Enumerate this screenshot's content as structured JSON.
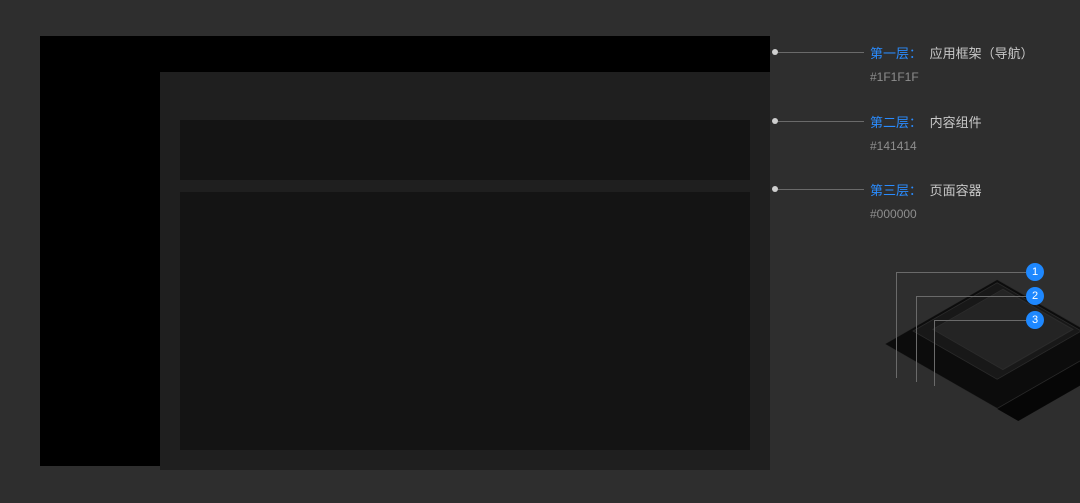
{
  "layers": [
    {
      "label_prefix": "第一层：",
      "label_desc": "应用框架（导航）",
      "color_hex": "#1F1F1F",
      "badge": "1"
    },
    {
      "label_prefix": "第二层：",
      "label_desc": "内容组件",
      "color_hex": "#141414",
      "badge": "2"
    },
    {
      "label_prefix": "第三层：",
      "label_desc": "页面容器",
      "color_hex": "#000000",
      "badge": "3"
    }
  ],
  "colors": {
    "accent": "#1e88ff",
    "page_bg": "#2e2e2e"
  }
}
